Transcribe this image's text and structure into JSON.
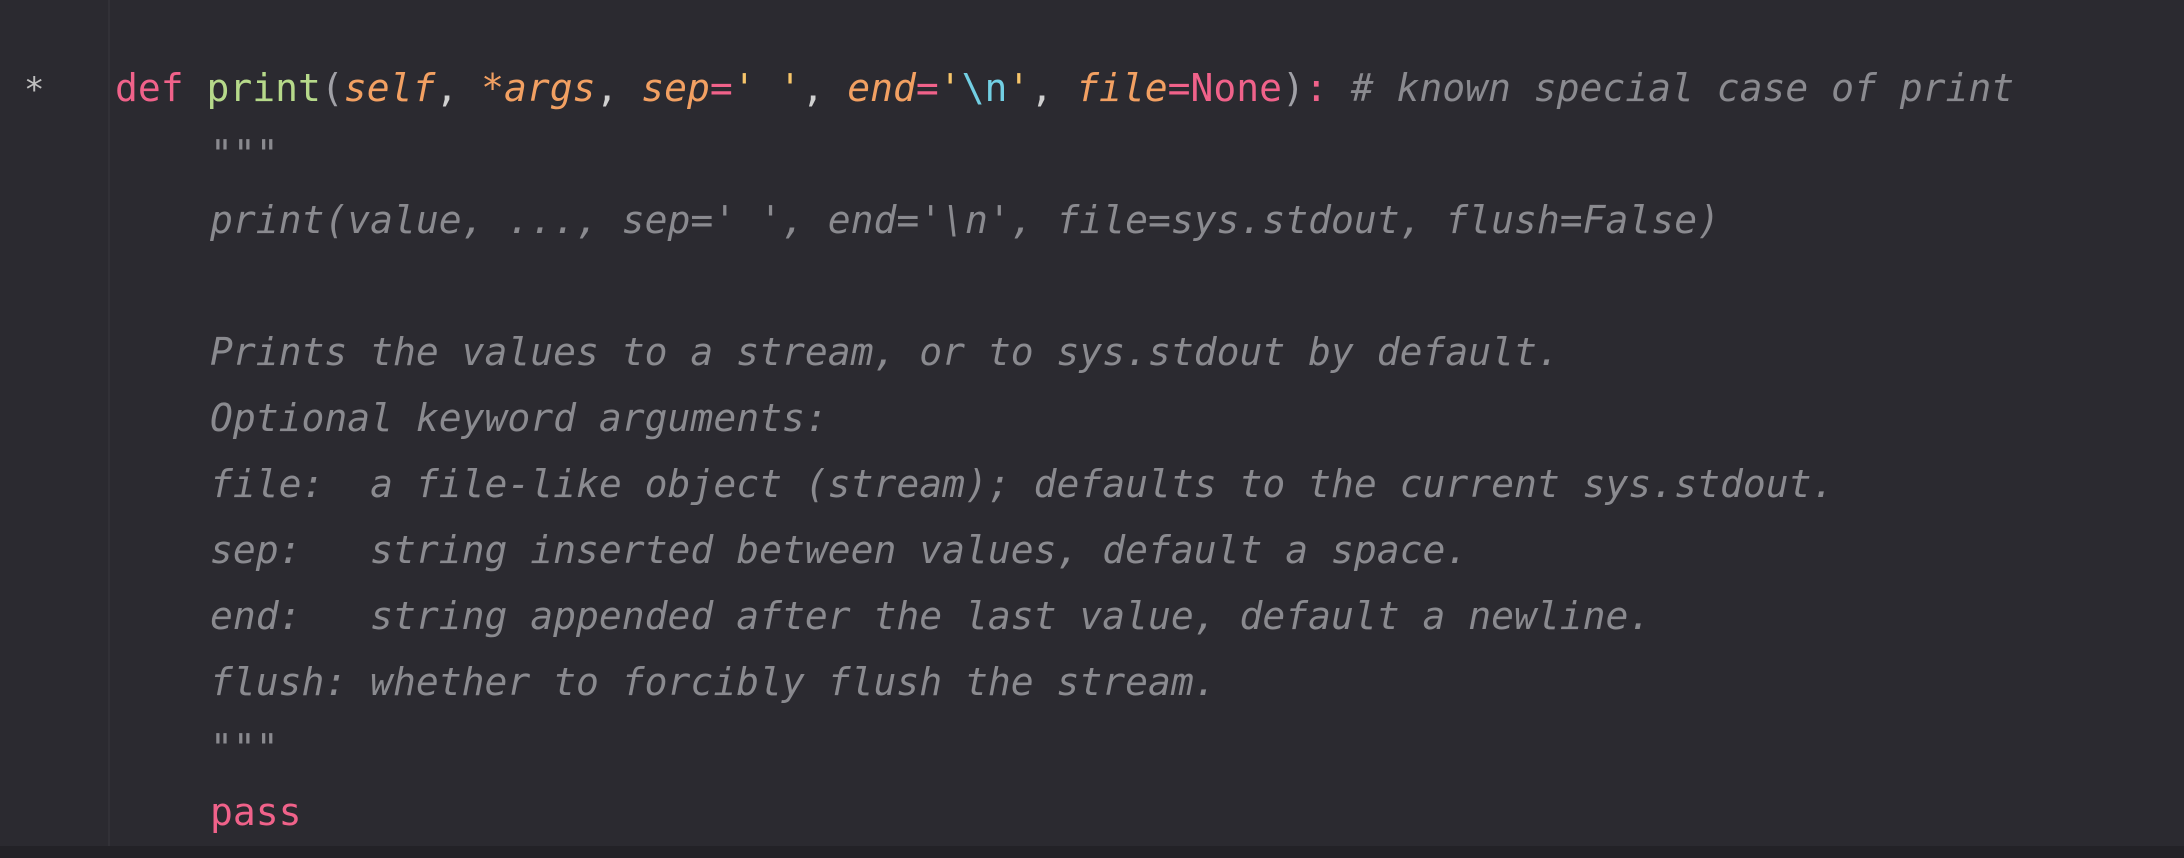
{
  "gutter": {
    "marker": "*"
  },
  "signature": {
    "keyword": "def",
    "function_name": "print",
    "open_paren": "(",
    "param_self": "self",
    "comma_1": ",",
    "param_args": "*args",
    "comma_2": ",",
    "param_sep": "sep",
    "eq_sep": "=",
    "sep_default": "' '",
    "comma_3": ",",
    "param_end": "end",
    "eq_end": "=",
    "end_quote_open": "'",
    "end_escape": "\\n",
    "end_quote_close": "'",
    "comma_4": ",",
    "param_file": "file",
    "eq_file": "=",
    "file_default": "None",
    "close_paren": ")",
    "colon": ":",
    "comment": "# known special case of print"
  },
  "docstring": {
    "open_quotes": "\"\"\"",
    "line_usage": "print(value, ..., sep=' ', end='\\n', file=sys.stdout, flush=False)",
    "line_blank": "",
    "line_desc": "Prints the values to a stream, or to sys.stdout by default.",
    "line_optional": "Optional keyword arguments:",
    "line_file": "file:  a file-like object (stream); defaults to the current sys.stdout.",
    "line_sep": "sep:   string inserted between values, default a space.",
    "line_end": "end:   string appended after the last value, default a newline.",
    "line_flush": "flush: whether to forcibly flush the stream.",
    "close_quotes": "\"\"\""
  },
  "body": {
    "pass_keyword": "pass"
  }
}
